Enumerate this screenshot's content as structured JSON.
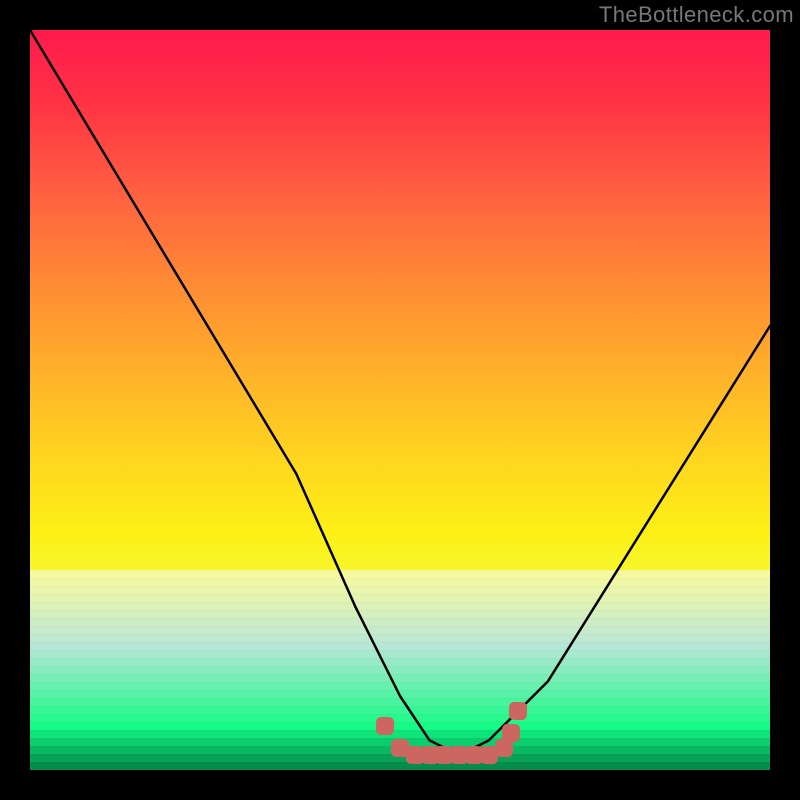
{
  "watermark": "TheBottleneck.com",
  "chart_data": {
    "type": "line",
    "title": "",
    "xlabel": "",
    "ylabel": "",
    "xlim": [
      0,
      100
    ],
    "ylim": [
      0,
      100
    ],
    "series": [
      {
        "name": "bottleneck-curve",
        "x": [
          0,
          12,
          24,
          36,
          44,
          50,
          54,
          58,
          62,
          70,
          80,
          90,
          100
        ],
        "values": [
          100,
          80,
          60,
          40,
          22,
          10,
          4,
          2,
          4,
          12,
          28,
          44,
          60
        ]
      }
    ],
    "markers": {
      "name": "optimal-region",
      "x": [
        48,
        50,
        52,
        54,
        56,
        58,
        60,
        62,
        64,
        65,
        66
      ],
      "values": [
        6,
        3,
        2,
        2,
        2,
        2,
        2,
        2,
        3,
        5,
        8
      ]
    },
    "gradient_stops": [
      {
        "pos": 0,
        "color": "#ff1a4d"
      },
      {
        "pos": 10,
        "color": "#ff3344"
      },
      {
        "pos": 22,
        "color": "#ff6040"
      },
      {
        "pos": 34,
        "color": "#ff8a35"
      },
      {
        "pos": 46,
        "color": "#ffb02a"
      },
      {
        "pos": 58,
        "color": "#ffd61f"
      },
      {
        "pos": 68,
        "color": "#fcf015"
      },
      {
        "pos": 76,
        "color": "#f5fa3a"
      },
      {
        "pos": 84,
        "color": "#cfff6a"
      },
      {
        "pos": 92,
        "color": "#80ff80"
      },
      {
        "pos": 100,
        "color": "#00e060"
      }
    ],
    "band_colors": [
      "#f7f9a0",
      "#f0f7a6",
      "#e9f5ac",
      "#e2f3b2",
      "#dbf1b8",
      "#d4efbe",
      "#cdecc4",
      "#c6eaca",
      "#bfe8d0",
      "#b8e6d6",
      "#a8e8ce",
      "#98eac6",
      "#88ecbe",
      "#78eeb6",
      "#68f0ae",
      "#58f2a6",
      "#48f49e",
      "#38f696",
      "#28f88e",
      "#18fa86",
      "#0ee47a",
      "#0cce6e",
      "#0ab862",
      "#08a256",
      "#068c4a"
    ]
  }
}
